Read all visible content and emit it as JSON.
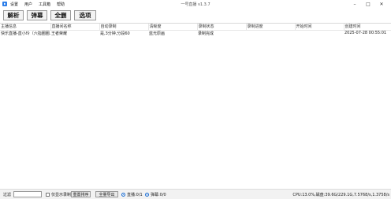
{
  "window": {
    "title": "一号直播 v1.3.7"
  },
  "menu": [
    "设置",
    "用户",
    "工具箱",
    "帮助"
  ],
  "toolbar": [
    "解析",
    "弹幕",
    "全删",
    "选项"
  ],
  "table": {
    "columns": [
      "主播信息",
      "直播间名称",
      "自动录制",
      "清晰度",
      "录制状态",
      "录制进度",
      "开始时间",
      "创建时间"
    ],
    "rows": [
      [
        "快乐直播-直小玲（六指圈圈...",
        "王者荣耀",
        "是,3分钟,分段60",
        "蓝光原画",
        "录制完成",
        "",
        "",
        "2025-07-28 00:55:01"
      ]
    ]
  },
  "statusbar": {
    "filter_label": "过滤",
    "filter_value": "",
    "only_recording_label": "仅显示录制中",
    "reset_sort_label": "重置排序",
    "export_all_label": "全量导出",
    "live_label": "直播:0/1",
    "danmaku_label": "弹幕:0/0",
    "stats": "CPU:13.0%,磁盘:39.6G/229.1G,7.5768/s,1.3758/s"
  }
}
